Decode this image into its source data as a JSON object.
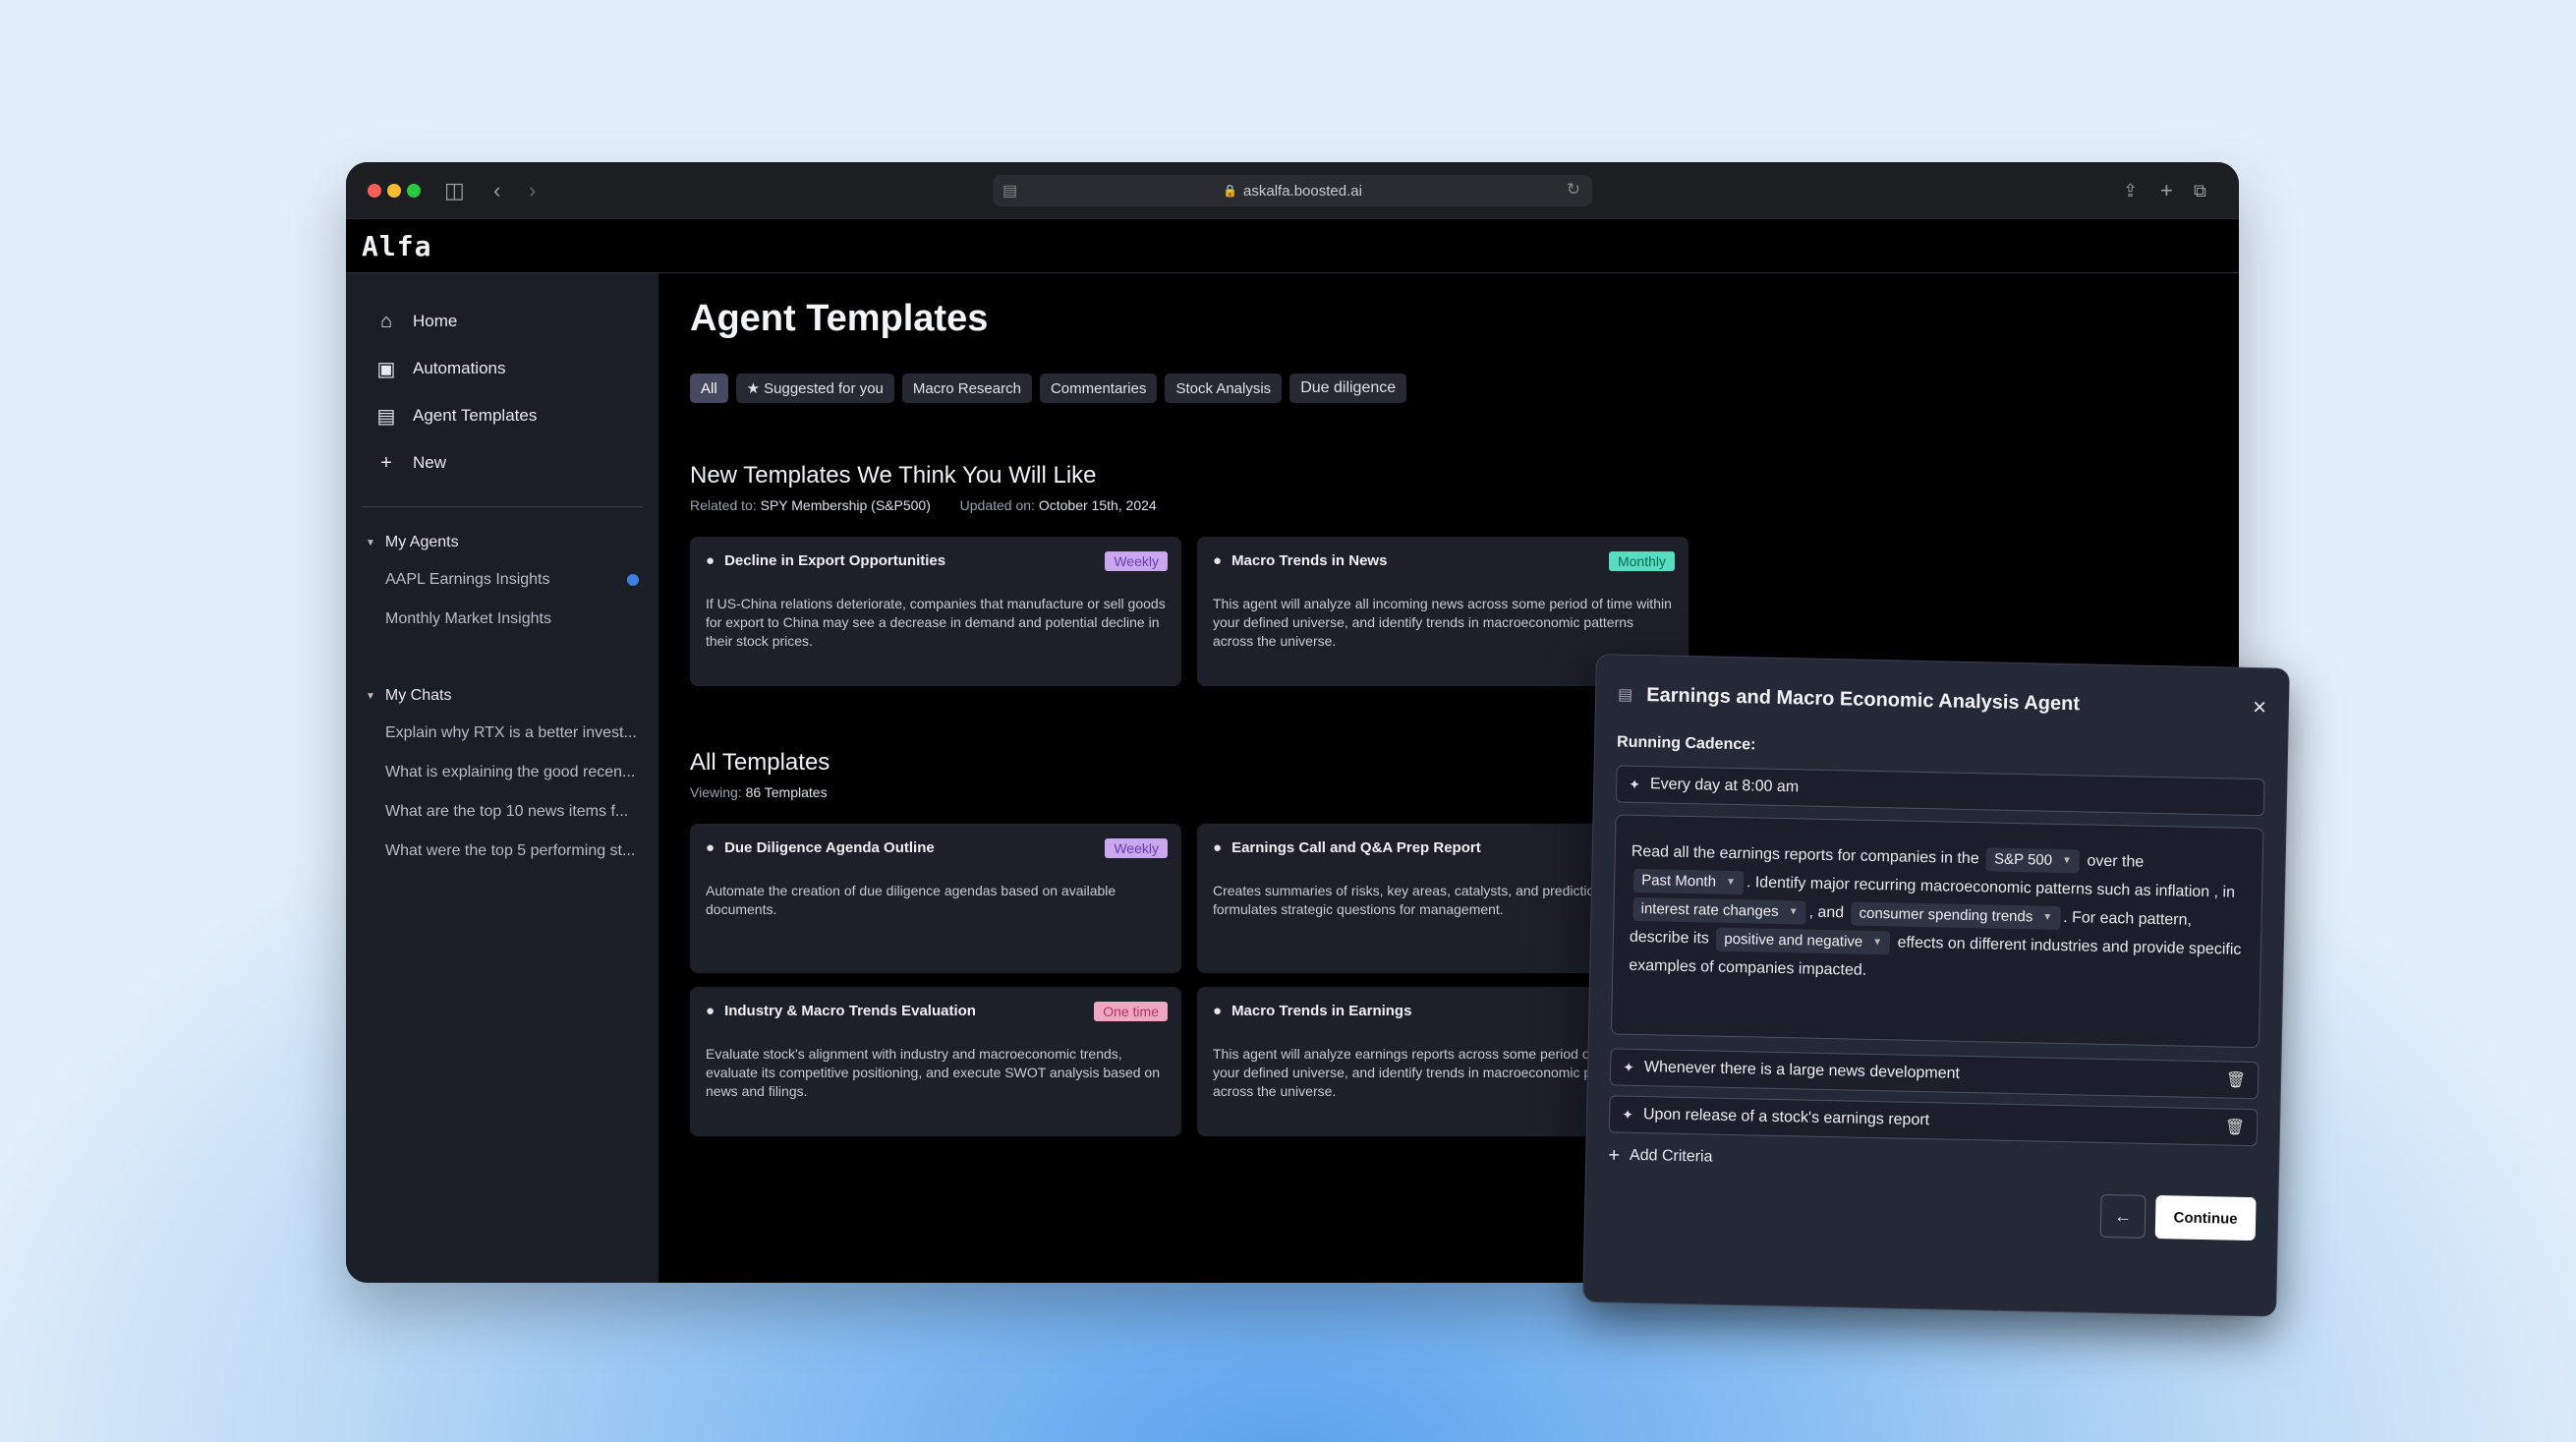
{
  "browser": {
    "url": "askalfa.boosted.ai"
  },
  "app": {
    "logo": "Alfa"
  },
  "sidebar": {
    "nav": [
      {
        "label": "Home",
        "icon": "home-icon"
      },
      {
        "label": "Automations",
        "icon": "robot-icon"
      },
      {
        "label": "Agent Templates",
        "icon": "library-icon"
      },
      {
        "label": "New",
        "icon": "plus-icon"
      }
    ],
    "my_agents_label": "My Agents",
    "agents": [
      {
        "label": "AAPL Earnings Insights",
        "unread": true
      },
      {
        "label": "Monthly Market Insights",
        "unread": false
      }
    ],
    "my_chats_label": "My Chats",
    "chats": [
      "Explain why RTX is a better invest...",
      "What is explaining the good recen...",
      "What are the top 10 news items f...",
      "What were the top 5 performing st..."
    ]
  },
  "main": {
    "title": "Agent Templates",
    "filters": [
      "All",
      "Suggested for you",
      "Macro Research",
      "Commentaries",
      "Stock Analysis",
      "Due diligence"
    ],
    "new_section": {
      "title": "New Templates We Think You Will Like",
      "related_label": "Related to:",
      "related_value": "SPY Membership (S&P500)",
      "updated_label": "Updated on:",
      "updated_value": "October 15th, 2024",
      "cards": [
        {
          "title": "Decline in Export Opportunities",
          "tag": "Weekly",
          "desc": "If US-China relations deteriorate, companies that manufacture or sell goods for export to China may see a decrease in demand and potential decline in their stock prices."
        },
        {
          "title": "Macro Trends in News",
          "tag": "Monthly",
          "desc": "This agent will analyze all incoming news across some period of time within your defined universe, and identify trends in macroeconomic patterns across the universe."
        }
      ]
    },
    "all_section": {
      "title": "All Templates",
      "viewing_label": "Viewing:",
      "viewing_value": "86 Templates",
      "cards": [
        {
          "title": "Due Diligence Agenda Outline",
          "tag": "Weekly",
          "desc": "Automate the creation of due diligence agendas based on available documents."
        },
        {
          "title": "Earnings Call and Q&A Prep Report",
          "tag": "",
          "desc": "Creates summaries of risks, key areas, catalysts, and predictions, and formulates strategic questions for management."
        },
        {
          "title": "Industry & Macro Trends Evaluation",
          "tag": "One time",
          "desc": "Evaluate stock's alignment with industry and macroeconomic trends, evaluate its competitive positioning, and execute SWOT analysis based on news and filings."
        },
        {
          "title": "Macro Trends in Earnings",
          "tag": "",
          "desc": "This agent will analyze earnings reports across some period of time within your defined universe, and identify trends in macroeconomic patterns across the universe."
        }
      ]
    }
  },
  "modal": {
    "title": "Earnings and Macro Economic Analysis Agent",
    "running_cadence_label": "Running Cadence:",
    "cadence_value": "Every day at 8:00 am",
    "prompt": {
      "t1": "Read all the earnings reports for companies in the",
      "p1": "S&P 500",
      "t2": "over the",
      "p2": "Past Month",
      "t3": ". Identify major recurring macroeconomic patterns such as inflation , in",
      "p3": "interest rate changes",
      "t4": ", and",
      "p4": "consumer spending trends",
      "t5": ". For each pattern, describe its",
      "p5": "positive and negative",
      "t6": "effects on different industries and provide specific examples of companies impacted."
    },
    "criteria": [
      "Whenever there is a large news development",
      "Upon release of a stock's earnings report"
    ],
    "add_criteria_label": "Add Criteria",
    "continue_label": "Continue"
  }
}
